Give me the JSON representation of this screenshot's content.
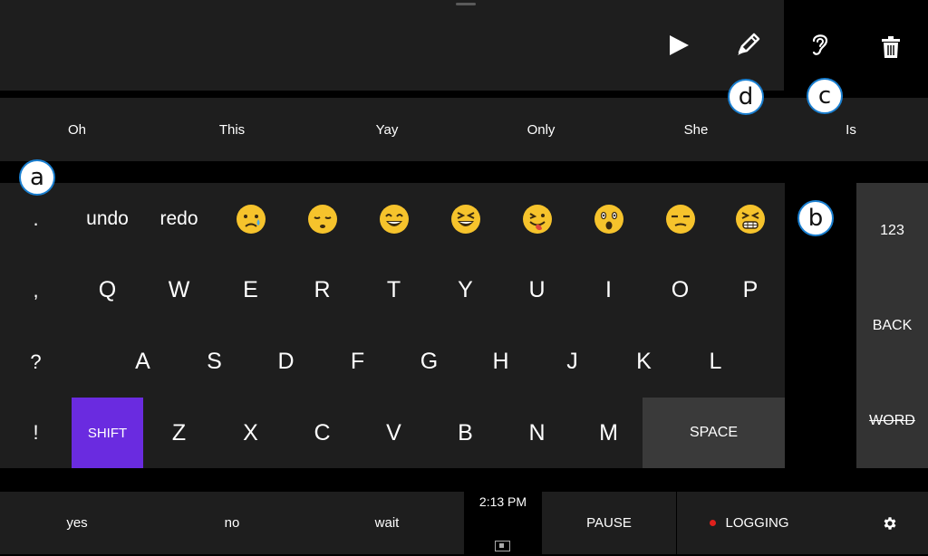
{
  "toolbar": {
    "icons": [
      "play-icon",
      "pencil-icon",
      "ear-icon",
      "trash-icon"
    ]
  },
  "suggestions": [
    "Oh",
    "This",
    "Yay",
    "Only",
    "She",
    "Is"
  ],
  "keyboard": {
    "row0": {
      "punct": ".",
      "undo": "undo",
      "redo": "redo",
      "emojis": [
        "crying-face",
        "sleepy-face",
        "grinning-face",
        "laughing-face",
        "tongue-face",
        "surprised-face",
        "unamused-face",
        "grimacing-face"
      ]
    },
    "row1": {
      "punct": ",",
      "keys": [
        "Q",
        "W",
        "E",
        "R",
        "T",
        "Y",
        "U",
        "I",
        "O",
        "P"
      ]
    },
    "row2": {
      "punct": "?",
      "keys": [
        "A",
        "S",
        "D",
        "F",
        "G",
        "H",
        "J",
        "K",
        "L"
      ]
    },
    "row3": {
      "punct": "!",
      "shift": "SHIFT",
      "keys": [
        "Z",
        "X",
        "C",
        "V",
        "B",
        "N",
        "M"
      ],
      "space": "SPACE"
    }
  },
  "side_keys": {
    "numbers": "123",
    "back": "BACK",
    "word": "WORD"
  },
  "bottom_bar": {
    "yes": "yes",
    "no": "no",
    "wait": "wait",
    "time": "2:13 PM",
    "pause": "PAUSE",
    "logging": "LOGGING"
  },
  "callouts": {
    "a": "a",
    "b": "b",
    "c": "c",
    "d": "d"
  },
  "colors": {
    "accent_shift": "#6a2be0",
    "key_background": "#1e1e1e",
    "space_key": "#3a3a3a",
    "side_column": "#333333",
    "logging_dot": "#e0201c",
    "callout_border": "#1a7fd0",
    "emoji_yellow": "#f6c32c"
  }
}
